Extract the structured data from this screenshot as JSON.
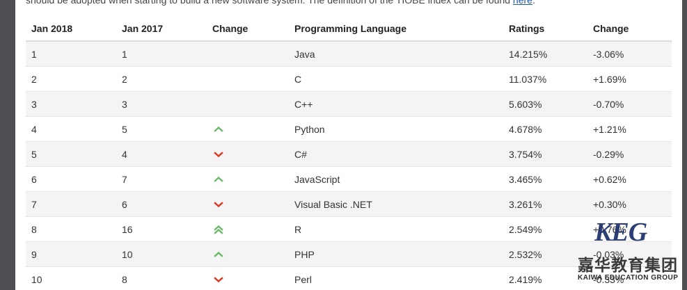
{
  "intro": {
    "text": "should be adopted when starting to build a new software system. The definition of the TIOBE index can be found ",
    "link": "here",
    "end": "."
  },
  "table": {
    "headers": [
      "Jan 2018",
      "Jan 2017",
      "Change",
      "Programming Language",
      "Ratings",
      "Change"
    ],
    "rows": [
      {
        "rank2018": "1",
        "rank2017": "1",
        "trend": "none",
        "language": "Java",
        "rating": "14.215%",
        "change": "-3.06%"
      },
      {
        "rank2018": "2",
        "rank2017": "2",
        "trend": "none",
        "language": "C",
        "rating": "11.037%",
        "change": "+1.69%"
      },
      {
        "rank2018": "3",
        "rank2017": "3",
        "trend": "none",
        "language": "C++",
        "rating": "5.603%",
        "change": "-0.70%"
      },
      {
        "rank2018": "4",
        "rank2017": "5",
        "trend": "up",
        "language": "Python",
        "rating": "4.678%",
        "change": "+1.21%"
      },
      {
        "rank2018": "5",
        "rank2017": "4",
        "trend": "down",
        "language": "C#",
        "rating": "3.754%",
        "change": "-0.29%"
      },
      {
        "rank2018": "6",
        "rank2017": "7",
        "trend": "up",
        "language": "JavaScript",
        "rating": "3.465%",
        "change": "+0.62%"
      },
      {
        "rank2018": "7",
        "rank2017": "6",
        "trend": "down",
        "language": "Visual Basic .NET",
        "rating": "3.261%",
        "change": "+0.30%"
      },
      {
        "rank2018": "8",
        "rank2017": "16",
        "trend": "up-double",
        "language": "R",
        "rating": "2.549%",
        "change": "+0.76%"
      },
      {
        "rank2018": "9",
        "rank2017": "10",
        "trend": "up",
        "language": "PHP",
        "rating": "2.532%",
        "change": "-0.03%"
      },
      {
        "rank2018": "10",
        "rank2017": "8",
        "trend": "down",
        "language": "Perl",
        "rating": "2.419%",
        "change": "-0.33%"
      }
    ]
  },
  "icons": {
    "up": "chevron-up-icon",
    "down": "chevron-down-icon",
    "up-double": "double-chevron-up-icon"
  },
  "colors": {
    "up": "#6cb86a",
    "down": "#d9381e",
    "stripe": "#f4f4f4",
    "link": "#1a5aa8"
  },
  "watermark": {
    "logo": "KEG",
    "chinese": "嘉华教育集团",
    "english": "KAIWA EDUCATION GROUP"
  }
}
